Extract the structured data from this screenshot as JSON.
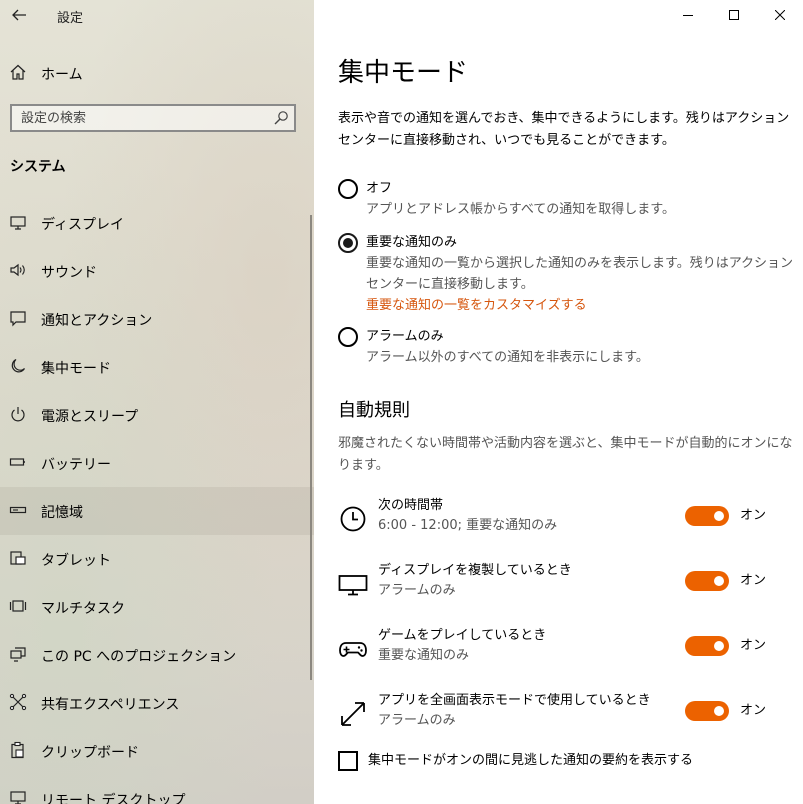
{
  "window": {
    "title": "設定"
  },
  "sidebar": {
    "home_label": "ホーム",
    "search_placeholder": "設定の検索",
    "section_heading": "システム",
    "items": [
      {
        "label": "ディスプレイ",
        "icon": "monitor-icon"
      },
      {
        "label": "サウンド",
        "icon": "speaker-icon"
      },
      {
        "label": "通知とアクション",
        "icon": "notification-icon"
      },
      {
        "label": "集中モード",
        "icon": "moon-icon"
      },
      {
        "label": "電源とスリープ",
        "icon": "power-icon"
      },
      {
        "label": "バッテリー",
        "icon": "battery-icon"
      },
      {
        "label": "記憶域",
        "icon": "storage-icon",
        "selected": true
      },
      {
        "label": "タブレット",
        "icon": "tablet-icon"
      },
      {
        "label": "マルチタスク",
        "icon": "multitask-icon"
      },
      {
        "label": "この PC へのプロジェクション",
        "icon": "projection-icon"
      },
      {
        "label": "共有エクスペリエンス",
        "icon": "share-icon"
      },
      {
        "label": "クリップボード",
        "icon": "clipboard-icon"
      },
      {
        "label": "リモート デスクトップ",
        "icon": "remote-desktop-icon"
      }
    ]
  },
  "main": {
    "title": "集中モード",
    "description": "表示や音での通知を選んでおき、集中できるようにします。残りはアクション センターに直接移動され、いつでも見ることができます。",
    "options": [
      {
        "label": "オフ",
        "description": "アプリとアドレス帳からすべての通知を取得します。",
        "checked": false
      },
      {
        "label": "重要な通知のみ",
        "description": "重要な通知の一覧から選択した通知のみを表示します。残りはアクション センターに直接移動します。",
        "checked": true,
        "link": "重要な通知の一覧をカスタマイズする"
      },
      {
        "label": "アラームのみ",
        "description": "アラーム以外のすべての通知を非表示にします。",
        "checked": false
      }
    ],
    "auto_rules": {
      "heading": "自動規則",
      "description": "邪魔されたくない時間帯や活動内容を選ぶと、集中モードが自動的にオンになります。",
      "rules": [
        {
          "title": "次の時間帯",
          "subtitle": "6:00 - 12:00; 重要な通知のみ",
          "icon": "clock-icon",
          "state": "オン"
        },
        {
          "title": "ディスプレイを複製しているとき",
          "subtitle": "アラームのみ",
          "icon": "monitor-icon",
          "state": "オン"
        },
        {
          "title": "ゲームをプレイしているとき",
          "subtitle": "重要な通知のみ",
          "icon": "gamepad-icon",
          "state": "オン"
        },
        {
          "title": "アプリを全画面表示モードで使用しているとき",
          "subtitle": "アラームのみ",
          "icon": "fullscreen-icon",
          "state": "オン"
        }
      ]
    },
    "summary_checkbox": {
      "label": "集中モードがオンの間に見逃した通知の要約を表示する",
      "checked": false
    }
  },
  "colors": {
    "accent": "#ec6200",
    "link": "#d6560e"
  }
}
